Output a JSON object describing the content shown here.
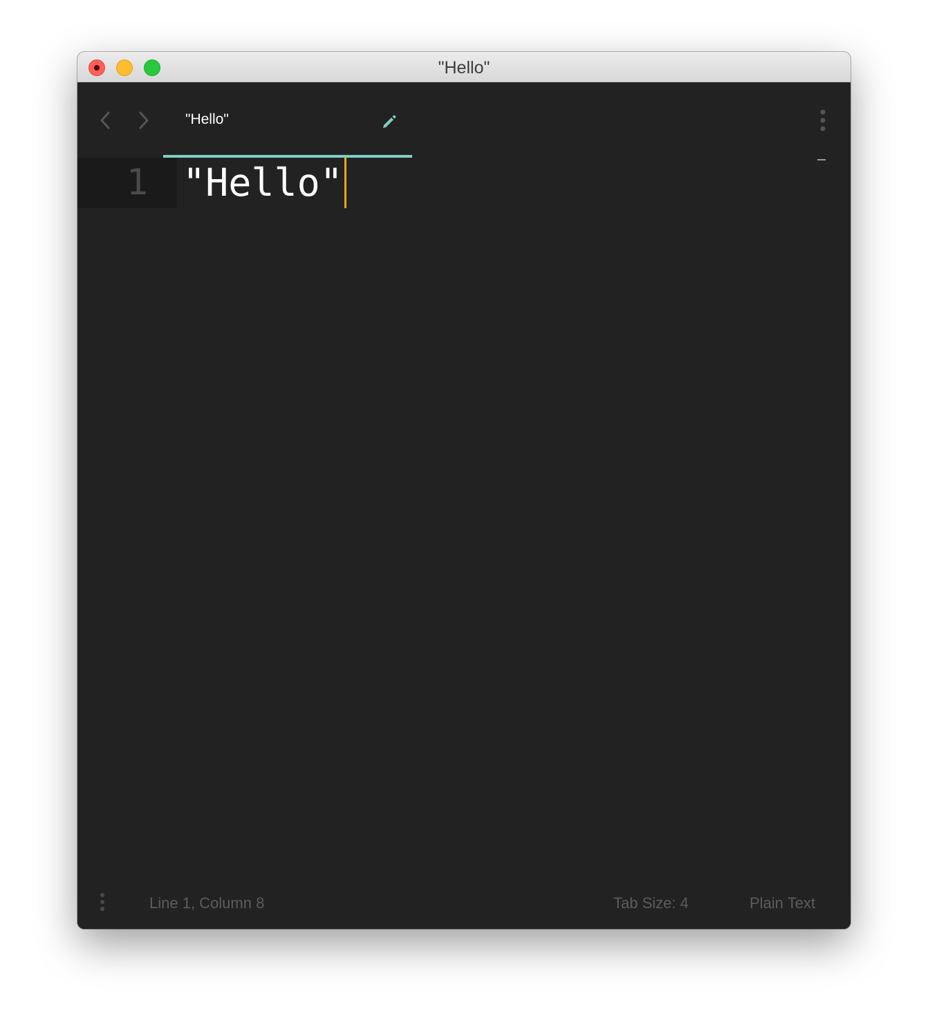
{
  "window": {
    "title": "\"Hello\""
  },
  "tabbar": {
    "tabs": [
      {
        "label": "\"Hello\"",
        "active": true
      }
    ],
    "accent_color": "#7fcfc4",
    "icons": [
      "chevron-left-icon",
      "chevron-right-icon",
      "pencil-icon",
      "vertical-ellipsis-icon"
    ]
  },
  "editor": {
    "lines": [
      {
        "number": "1",
        "text": "\"Hello\""
      }
    ],
    "caret_color": "#e6a817",
    "background": "#222222"
  },
  "statusbar": {
    "position": "Line 1, Column 8",
    "tab_size": "Tab Size: 4",
    "syntax": "Plain Text"
  }
}
